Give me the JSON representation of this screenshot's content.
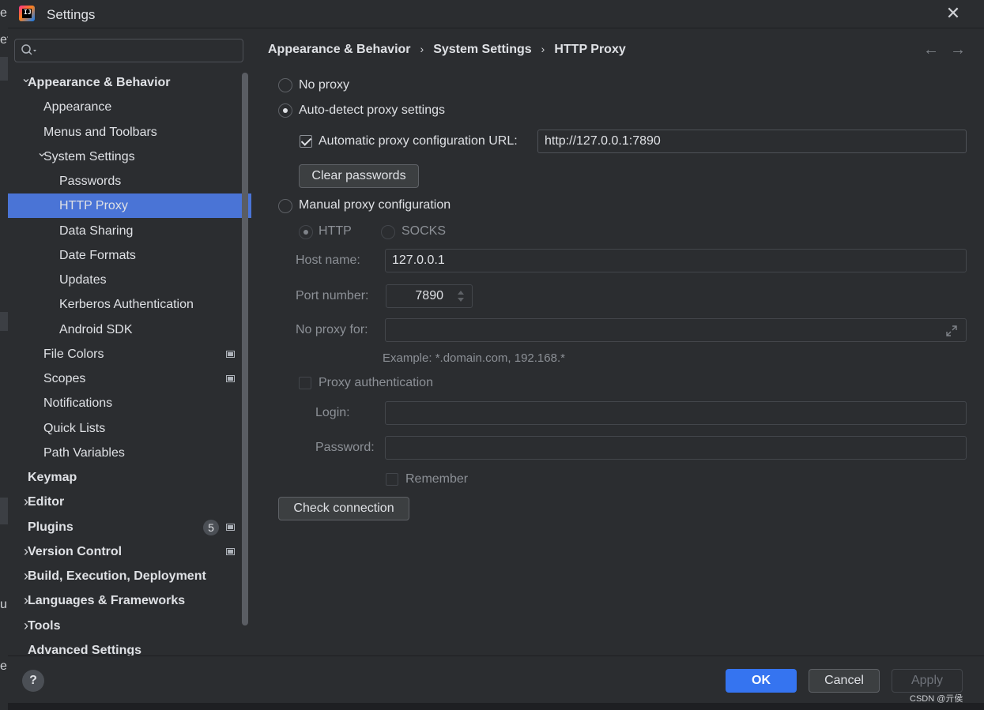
{
  "window": {
    "title": "Settings"
  },
  "background": {
    "left_fragments": [
      "e",
      "ef",
      "e",
      "u"
    ]
  },
  "search": {
    "placeholder": ""
  },
  "sidebar": {
    "items": [
      {
        "label": "Appearance & Behavior",
        "level": 0,
        "bold": true,
        "arrow": "down"
      },
      {
        "label": "Appearance",
        "level": 1
      },
      {
        "label": "Menus and Toolbars",
        "level": 1
      },
      {
        "label": "System Settings",
        "level": 1,
        "arrow": "down"
      },
      {
        "label": "Passwords",
        "level": 2
      },
      {
        "label": "HTTP Proxy",
        "level": 2,
        "selected": true
      },
      {
        "label": "Data Sharing",
        "level": 2
      },
      {
        "label": "Date Formats",
        "level": 2
      },
      {
        "label": "Updates",
        "level": 2
      },
      {
        "label": "Kerberos Authentication",
        "level": 2
      },
      {
        "label": "Android SDK",
        "level": 2
      },
      {
        "label": "File Colors",
        "level": 1,
        "page_icon": true
      },
      {
        "label": "Scopes",
        "level": 1,
        "page_icon": true
      },
      {
        "label": "Notifications",
        "level": 1
      },
      {
        "label": "Quick Lists",
        "level": 1
      },
      {
        "label": "Path Variables",
        "level": 1
      },
      {
        "label": "Keymap",
        "level": 0,
        "bold": true
      },
      {
        "label": "Editor",
        "level": 0,
        "bold": true,
        "arrow": "right"
      },
      {
        "label": "Plugins",
        "level": 0,
        "bold": true,
        "badge": "5",
        "page_icon": true
      },
      {
        "label": "Version Control",
        "level": 0,
        "bold": true,
        "arrow": "right",
        "page_icon": true
      },
      {
        "label": "Build, Execution, Deployment",
        "level": 0,
        "bold": true,
        "arrow": "right"
      },
      {
        "label": "Languages & Frameworks",
        "level": 0,
        "bold": true,
        "arrow": "right"
      },
      {
        "label": "Tools",
        "level": 0,
        "bold": true,
        "arrow": "right"
      },
      {
        "label": "Advanced Settings",
        "level": 0,
        "bold": true
      }
    ]
  },
  "breadcrumb": [
    "Appearance & Behavior",
    "System Settings",
    "HTTP Proxy"
  ],
  "proxy": {
    "no_proxy_label": "No proxy",
    "auto_detect_label": "Auto-detect proxy settings",
    "auto_config_url_label": "Automatic proxy configuration URL:",
    "auto_config_url_value": "http://127.0.0.1:7890",
    "clear_passwords_label": "Clear passwords",
    "manual_label": "Manual proxy configuration",
    "http_label": "HTTP",
    "socks_label": "SOCKS",
    "host_label": "Host name:",
    "host_value": "127.0.0.1",
    "port_label": "Port number:",
    "port_value": "7890",
    "no_proxy_for_label": "No proxy for:",
    "no_proxy_for_value": "",
    "example_text": "Example: *.domain.com, 192.168.*",
    "auth_label": "Proxy authentication",
    "login_label": "Login:",
    "login_value": "",
    "password_label": "Password:",
    "password_value": "",
    "remember_label": "Remember",
    "check_connection_label": "Check connection",
    "selected_mode": "auto-detect",
    "auto_config_url_checked": true,
    "manual_protocol": "HTTP",
    "auth_checked": false,
    "remember_checked": false
  },
  "footer": {
    "help_label": "?",
    "ok_label": "OK",
    "cancel_label": "Cancel",
    "apply_label": "Apply"
  },
  "watermark": "CSDN @亓侯",
  "colors": {
    "background": "#2b2d30",
    "selection": "#4a74d6",
    "primary_button": "#3574f0",
    "text": "#dfe1e5",
    "dim_text": "#8c9096"
  }
}
